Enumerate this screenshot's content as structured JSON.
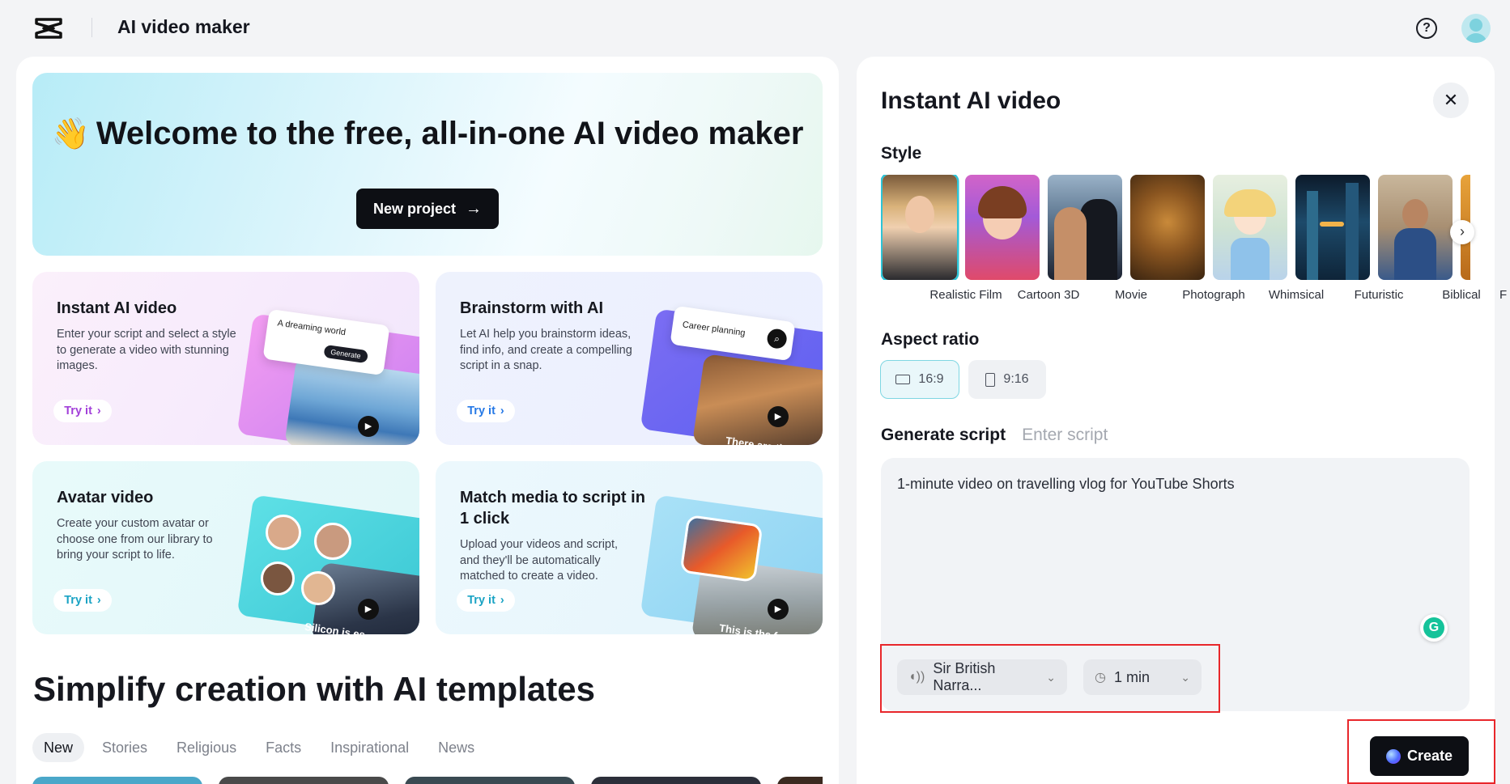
{
  "app": {
    "title": "AI video maker"
  },
  "hero": {
    "emoji": "👋",
    "title": "Welcome to the free, all-in-one AI video maker",
    "new_project_label": "New project",
    "new_project_arrow": "→"
  },
  "cards": [
    {
      "title": "Instant AI video",
      "desc": "Enter your script and select a style to generate a video with stunning images.",
      "try": "Try it",
      "art_text": "A dreaming world",
      "art_button": "Generate"
    },
    {
      "title": "Brainstorm with AI",
      "desc": "Let AI help you brainstorm ideas, find info, and create a compelling script in a snap.",
      "try": "Try it",
      "art_text": "Career planning",
      "art_caption": "There are th"
    },
    {
      "title": "Avatar video",
      "desc": "Create your custom avatar or choose one from our library to bring your script to life.",
      "try": "Try it",
      "art_caption": "Silicon is es"
    },
    {
      "title": "Match media to script in 1 click",
      "desc": "Upload your videos and script, and they'll be automatically matched to create a video.",
      "try": "Try it",
      "art_caption": "This is the fa"
    }
  ],
  "templates": {
    "title": "Simplify creation with AI templates",
    "tabs": [
      "New",
      "Stories",
      "Religious",
      "Facts",
      "Inspirational",
      "News"
    ]
  },
  "panel": {
    "title": "Instant AI video",
    "style_label": "Style",
    "styles": [
      "Realistic Film",
      "Cartoon 3D",
      "Movie",
      "Photograph",
      "Whimsical",
      "Futuristic",
      "Biblical",
      "F"
    ],
    "aspect_label": "Aspect ratio",
    "aspect_options": [
      "16:9",
      "9:16"
    ],
    "script_tabs": [
      "Generate script",
      "Enter script"
    ],
    "script_text": "1-minute video on travelling vlog for YouTube Shorts",
    "voice": "Sir British Narra...",
    "duration": "1 min",
    "create_label": "Create",
    "close_icon": "close-icon"
  },
  "colors": {
    "accent_cyan": "#2ec4d6",
    "highlight_red": "#e8272b",
    "button_dark": "#0d0f14",
    "try_purple": "#a23fd9",
    "try_blue": "#2679e6",
    "try_teal": "#1aa3c4"
  }
}
